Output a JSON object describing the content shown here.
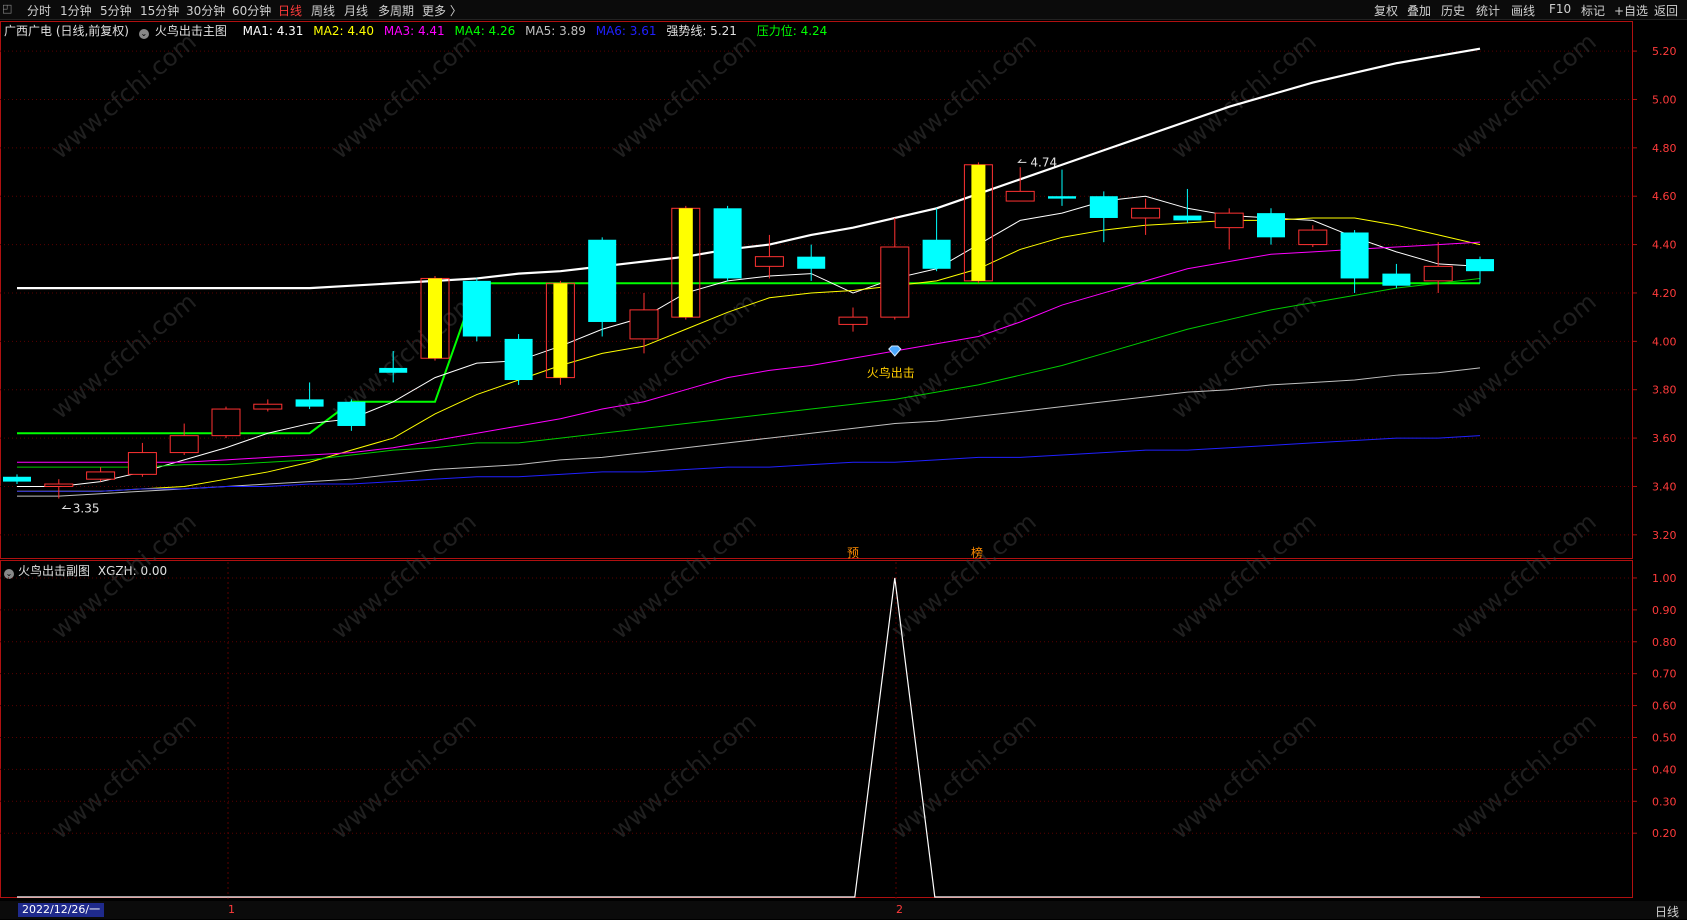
{
  "toolbar": {
    "periods": [
      "分时",
      "1分钟",
      "5分钟",
      "15分钟",
      "30分钟",
      "60分钟",
      "日线",
      "周线",
      "月线",
      "多周期",
      "更多 〉"
    ],
    "active_period": "日线",
    "right_buttons": [
      "复权",
      "叠加",
      "历史",
      "统计",
      "画线",
      "F10",
      "标记",
      "+自选",
      "返回"
    ]
  },
  "main_legend": {
    "stock": "广西广电 (日线,前复权)",
    "indicator": "火鸟出击主图",
    "ma": [
      {
        "label": "MA1: 4.31",
        "color": "#ffffff"
      },
      {
        "label": "MA2: 4.40",
        "color": "#ffff00"
      },
      {
        "label": "MA3: 4.41",
        "color": "#ff00ff"
      },
      {
        "label": "MA4: 4.26",
        "color": "#00ff00"
      },
      {
        "label": "MA5: 3.89",
        "color": "#c0c0c0"
      },
      {
        "label": "MA6: 3.61",
        "color": "#2020ff"
      }
    ],
    "strong_line": "强势线: 5.21",
    "pressure": "压力位: 4.24"
  },
  "sub_legend": {
    "title": "火鸟出击副图",
    "value": "XGZH: 0.00"
  },
  "annotations": {
    "high_label": "4.74",
    "low_label": "3.35",
    "signal_label": "火鸟出击",
    "marker_a": "预",
    "marker_b": "榜"
  },
  "bottom": {
    "date": "2022/12/26/一",
    "tick1": "1",
    "tick2": "2",
    "period": "日线"
  },
  "colors": {
    "up": "#ff3232",
    "down": "#00ffff",
    "strong": "#ffff00",
    "grid": "#5a0000",
    "axis": "#b01010"
  },
  "chart_data": {
    "type": "candlestick",
    "main_axis": {
      "ylim": [
        3.1,
        5.25
      ],
      "ticks": [
        "5.20",
        "5.00",
        "4.80",
        "4.60",
        "4.40",
        "4.20",
        "4.00",
        "3.80",
        "3.60",
        "3.40",
        "3.20"
      ]
    },
    "sub_axis": {
      "ylim": [
        0,
        1.05
      ],
      "ticks": [
        "1.00",
        "0.90",
        "0.80",
        "0.70",
        "0.60",
        "0.50",
        "0.40",
        "0.30",
        "0.20"
      ]
    },
    "candles": [
      {
        "o": 3.44,
        "c": 3.42,
        "h": 3.45,
        "l": 3.41,
        "s": "down"
      },
      {
        "o": 3.4,
        "c": 3.41,
        "h": 3.43,
        "l": 3.35,
        "s": "up"
      },
      {
        "o": 3.43,
        "c": 3.46,
        "h": 3.48,
        "l": 3.42,
        "s": "up"
      },
      {
        "o": 3.45,
        "c": 3.54,
        "h": 3.58,
        "l": 3.44,
        "s": "up"
      },
      {
        "o": 3.54,
        "c": 3.61,
        "h": 3.66,
        "l": 3.53,
        "s": "up"
      },
      {
        "o": 3.61,
        "c": 3.72,
        "h": 3.73,
        "l": 3.6,
        "s": "up"
      },
      {
        "o": 3.72,
        "c": 3.74,
        "h": 3.76,
        "l": 3.71,
        "s": "up"
      },
      {
        "o": 3.76,
        "c": 3.73,
        "h": 3.83,
        "l": 3.72,
        "s": "down"
      },
      {
        "o": 3.75,
        "c": 3.65,
        "h": 3.76,
        "l": 3.63,
        "s": "down"
      },
      {
        "o": 3.87,
        "c": 3.89,
        "h": 3.96,
        "l": 3.83,
        "s": "down"
      },
      {
        "o": 3.93,
        "c": 4.26,
        "h": 4.27,
        "l": 3.92,
        "s": "strong"
      },
      {
        "o": 4.25,
        "c": 4.02,
        "h": 4.26,
        "l": 4.0,
        "s": "down"
      },
      {
        "o": 4.01,
        "c": 3.84,
        "h": 4.03,
        "l": 3.82,
        "s": "down"
      },
      {
        "o": 3.85,
        "c": 4.24,
        "h": 4.25,
        "l": 3.82,
        "s": "strong"
      },
      {
        "o": 4.42,
        "c": 4.08,
        "h": 4.43,
        "l": 4.02,
        "s": "down"
      },
      {
        "o": 4.01,
        "c": 4.13,
        "h": 4.2,
        "l": 3.95,
        "s": "up"
      },
      {
        "o": 4.1,
        "c": 4.55,
        "h": 4.56,
        "l": 4.09,
        "s": "strong"
      },
      {
        "o": 4.55,
        "c": 4.26,
        "h": 4.56,
        "l": 4.25,
        "s": "down"
      },
      {
        "o": 4.31,
        "c": 4.35,
        "h": 4.44,
        "l": 4.26,
        "s": "up"
      },
      {
        "o": 4.35,
        "c": 4.3,
        "h": 4.4,
        "l": 4.25,
        "s": "down"
      },
      {
        "o": 4.07,
        "c": 4.1,
        "h": 4.14,
        "l": 4.04,
        "s": "up"
      },
      {
        "o": 4.1,
        "c": 4.39,
        "h": 4.51,
        "l": 4.09,
        "s": "up"
      },
      {
        "o": 4.42,
        "c": 4.3,
        "h": 4.55,
        "l": 4.29,
        "s": "down"
      },
      {
        "o": 4.25,
        "c": 4.73,
        "h": 4.74,
        "l": 4.24,
        "s": "strong"
      },
      {
        "o": 4.58,
        "c": 4.62,
        "h": 4.72,
        "l": 4.58,
        "s": "up"
      },
      {
        "o": 4.6,
        "c": 4.59,
        "h": 4.71,
        "l": 4.56,
        "s": "down"
      },
      {
        "o": 4.6,
        "c": 4.51,
        "h": 4.62,
        "l": 4.41,
        "s": "down"
      },
      {
        "o": 4.51,
        "c": 4.55,
        "h": 4.59,
        "l": 4.44,
        "s": "up"
      },
      {
        "o": 4.52,
        "c": 4.5,
        "h": 4.63,
        "l": 4.49,
        "s": "down"
      },
      {
        "o": 4.47,
        "c": 4.53,
        "h": 4.55,
        "l": 4.38,
        "s": "up"
      },
      {
        "o": 4.53,
        "c": 4.43,
        "h": 4.55,
        "l": 4.4,
        "s": "down"
      },
      {
        "o": 4.4,
        "c": 4.46,
        "h": 4.48,
        "l": 4.39,
        "s": "up"
      },
      {
        "o": 4.45,
        "c": 4.26,
        "h": 4.46,
        "l": 4.2,
        "s": "down"
      },
      {
        "o": 4.28,
        "c": 4.23,
        "h": 4.32,
        "l": 4.22,
        "s": "down"
      },
      {
        "o": 4.25,
        "c": 4.31,
        "h": 4.41,
        "l": 4.2,
        "s": "up"
      },
      {
        "o": 4.34,
        "c": 4.29,
        "h": 4.35,
        "l": 4.24,
        "s": "down"
      }
    ],
    "strong_line": [
      4.22,
      4.22,
      4.22,
      4.22,
      4.22,
      4.22,
      4.22,
      4.22,
      4.23,
      4.24,
      4.25,
      4.26,
      4.28,
      4.29,
      4.31,
      4.33,
      4.35,
      4.38,
      4.4,
      4.44,
      4.47,
      4.51,
      4.55,
      4.61,
      4.67,
      4.73,
      4.79,
      4.85,
      4.91,
      4.97,
      5.02,
      5.07,
      5.11,
      5.15,
      5.18,
      5.21
    ],
    "pressure_line": [
      3.62,
      3.62,
      3.62,
      3.62,
      3.62,
      3.62,
      3.62,
      3.62,
      3.75,
      3.75,
      3.75,
      4.24,
      4.24,
      4.24,
      4.24,
      4.24,
      4.24,
      4.24,
      4.24,
      4.24,
      4.24,
      4.24,
      4.24,
      4.24,
      4.24,
      4.24,
      4.24,
      4.24,
      4.24,
      4.24,
      4.24,
      4.24,
      4.24,
      4.24,
      4.24,
      4.24
    ],
    "ma_lines": {
      "ma1": [
        3.4,
        3.4,
        3.42,
        3.46,
        3.51,
        3.56,
        3.62,
        3.66,
        3.68,
        3.75,
        3.85,
        3.91,
        3.92,
        3.98,
        4.05,
        4.1,
        4.2,
        4.25,
        4.27,
        4.28,
        4.2,
        4.26,
        4.3,
        4.4,
        4.5,
        4.53,
        4.58,
        4.6,
        4.55,
        4.52,
        4.51,
        4.5,
        4.43,
        4.37,
        4.32,
        4.31
      ],
      "ma2": [
        3.38,
        3.38,
        3.38,
        3.39,
        3.4,
        3.43,
        3.46,
        3.5,
        3.55,
        3.6,
        3.7,
        3.78,
        3.84,
        3.9,
        3.95,
        3.98,
        4.05,
        4.12,
        4.18,
        4.2,
        4.21,
        4.23,
        4.25,
        4.3,
        4.38,
        4.43,
        4.46,
        4.48,
        4.49,
        4.5,
        4.5,
        4.51,
        4.51,
        4.48,
        4.44,
        4.4
      ],
      "ma3": [
        3.5,
        3.5,
        3.5,
        3.5,
        3.5,
        3.51,
        3.52,
        3.53,
        3.54,
        3.56,
        3.59,
        3.62,
        3.65,
        3.68,
        3.72,
        3.75,
        3.8,
        3.85,
        3.88,
        3.9,
        3.93,
        3.96,
        3.99,
        4.02,
        4.08,
        4.15,
        4.2,
        4.25,
        4.3,
        4.33,
        4.36,
        4.37,
        4.38,
        4.39,
        4.4,
        4.41
      ],
      "ma4": [
        3.48,
        3.48,
        3.48,
        3.48,
        3.49,
        3.49,
        3.5,
        3.51,
        3.53,
        3.55,
        3.56,
        3.58,
        3.58,
        3.6,
        3.62,
        3.64,
        3.66,
        3.68,
        3.7,
        3.72,
        3.74,
        3.76,
        3.79,
        3.82,
        3.86,
        3.9,
        3.95,
        4.0,
        4.05,
        4.09,
        4.13,
        4.16,
        4.19,
        4.22,
        4.24,
        4.26
      ],
      "ma5": [
        3.36,
        3.36,
        3.37,
        3.38,
        3.39,
        3.4,
        3.41,
        3.42,
        3.43,
        3.45,
        3.47,
        3.48,
        3.49,
        3.51,
        3.52,
        3.54,
        3.56,
        3.58,
        3.6,
        3.62,
        3.64,
        3.66,
        3.67,
        3.69,
        3.71,
        3.73,
        3.75,
        3.77,
        3.79,
        3.8,
        3.82,
        3.83,
        3.84,
        3.86,
        3.87,
        3.89
      ],
      "ma6": [
        3.38,
        3.38,
        3.38,
        3.39,
        3.39,
        3.4,
        3.4,
        3.41,
        3.41,
        3.42,
        3.43,
        3.44,
        3.44,
        3.45,
        3.46,
        3.46,
        3.47,
        3.48,
        3.48,
        3.49,
        3.5,
        3.5,
        3.51,
        3.52,
        3.52,
        3.53,
        3.54,
        3.55,
        3.55,
        3.56,
        3.57,
        3.58,
        3.59,
        3.6,
        3.6,
        3.61
      ]
    },
    "sub_series": [
      0,
      0,
      0,
      0,
      0,
      0,
      0,
      0,
      0,
      0,
      0,
      0,
      0,
      0,
      0,
      0,
      0,
      0,
      0,
      0,
      0,
      1,
      0,
      0,
      0,
      0,
      0,
      0,
      0,
      0,
      0,
      0,
      0,
      0,
      0,
      0
    ]
  }
}
